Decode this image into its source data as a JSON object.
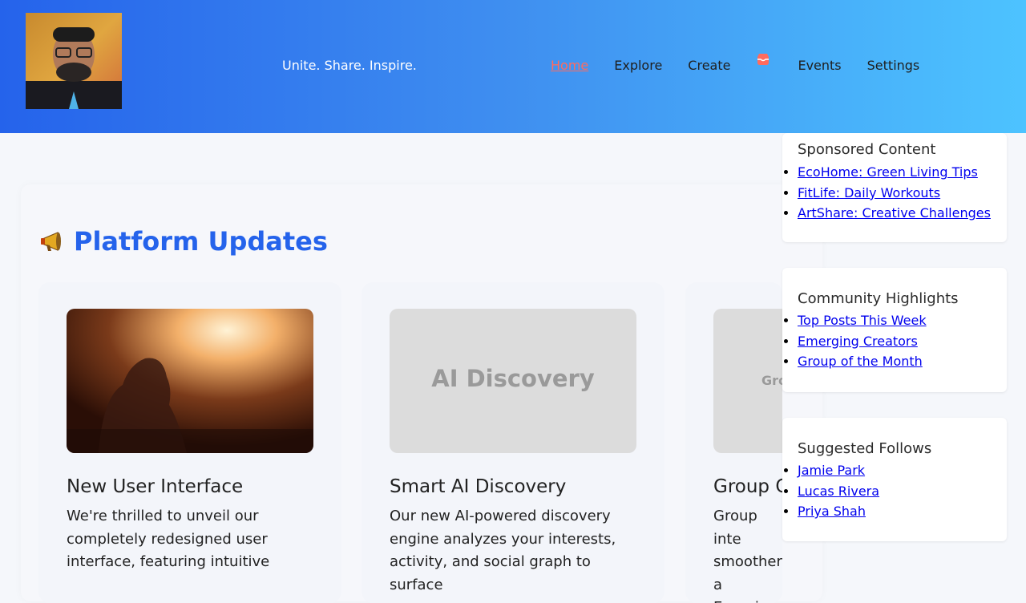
{
  "header": {
    "tagline": "Unite. Share. Inspire.",
    "nav": [
      {
        "label": "Home",
        "active": true
      },
      {
        "label": "Explore"
      },
      {
        "label": "Create"
      },
      {
        "label": "",
        "icon": "inbox-icon"
      },
      {
        "label": "Events"
      },
      {
        "label": "Settings"
      }
    ]
  },
  "updates": {
    "title": "Platform Updates",
    "title_icon": "megaphone-icon",
    "cards": [
      {
        "title": "New User Interface",
        "body": "We're thrilled to unveil our completely redesigned user interface, featuring intuitive",
        "thumb_text": ""
      },
      {
        "title": "Smart AI Discovery",
        "body": "Our new AI-powered discovery engine analyzes your interests, activity, and social graph to surface",
        "thumb_text": "AI Discovery"
      },
      {
        "title": "Group C",
        "body": "Group inte smoother a Experience",
        "thumb_text": "Gro"
      }
    ]
  },
  "sidebar": {
    "sponsored": {
      "title": "Sponsored Content",
      "links": [
        "EcoHome: Green Living Tips",
        "FitLife: Daily Workouts",
        "ArtShare: Creative Challenges"
      ]
    },
    "highlights": {
      "title": "Community Highlights",
      "links": [
        "Top Posts This Week",
        "Emerging Creators",
        "Group of the Month"
      ]
    },
    "follows": {
      "title": "Suggested Follows",
      "links": [
        "Jamie Park",
        "Lucas Rivera",
        "Priya Shah"
      ]
    }
  },
  "colors": {
    "brand": "#2563eb",
    "accent": "#ff6b5f",
    "link": "#0000ee"
  }
}
